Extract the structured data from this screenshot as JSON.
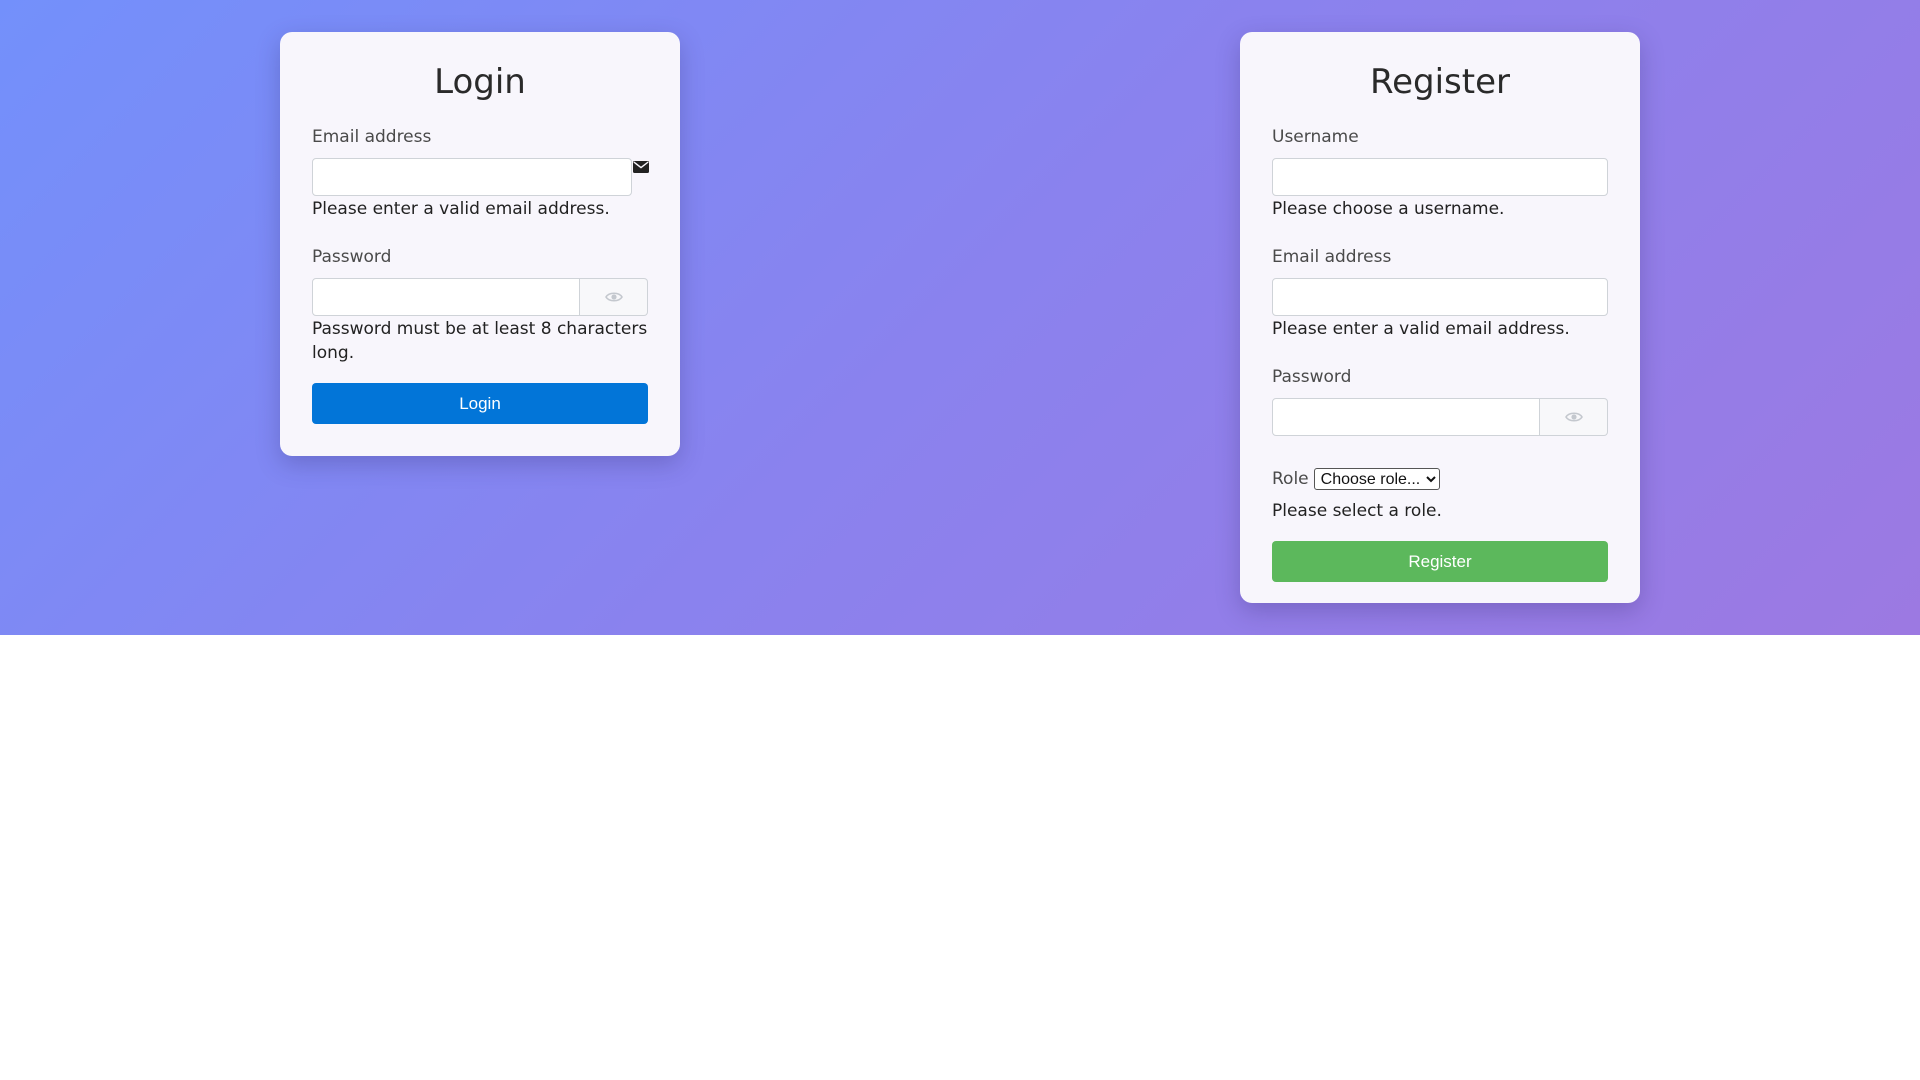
{
  "login": {
    "title": "Login",
    "email_label": "Email address",
    "email_value": "",
    "email_feedback": "Please enter a valid email address.",
    "password_label": "Password",
    "password_value": "",
    "password_feedback": "Password must be at least 8 characters long.",
    "submit_label": "Login",
    "icons": {
      "email": "envelope-icon",
      "password_toggle": "eye-icon"
    }
  },
  "register": {
    "title": "Register",
    "username_label": "Username",
    "username_value": "",
    "username_feedback": "Please choose a username.",
    "email_label": "Email address",
    "email_value": "",
    "email_feedback": "Please enter a valid email address.",
    "password_label": "Password",
    "password_value": "",
    "role_label": "Role",
    "role_selected": "Choose role...",
    "role_feedback": "Please select a role.",
    "submit_label": "Register",
    "icons": {
      "password_toggle": "eye-icon"
    }
  },
  "colors": {
    "background_gradient_start": "#7390fb",
    "background_gradient_end": "#9c79e2",
    "card_background": "#f8f6fc",
    "login_button": "#0275d8",
    "register_button": "#5cb85c"
  }
}
